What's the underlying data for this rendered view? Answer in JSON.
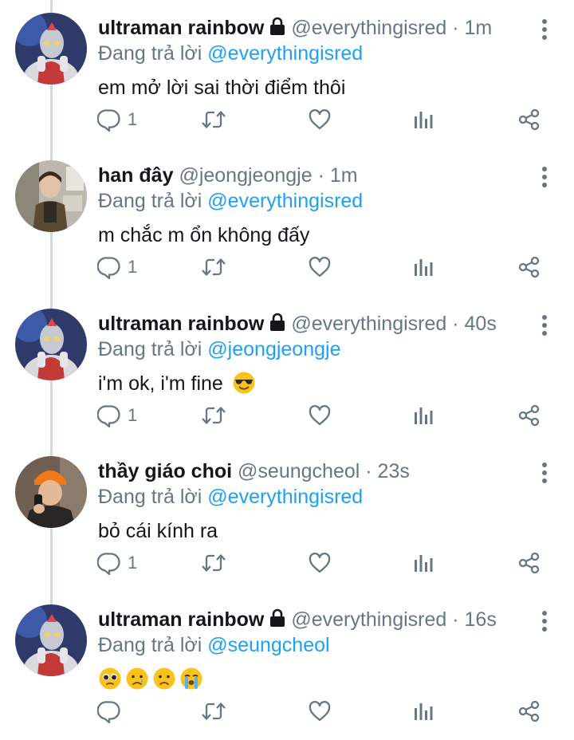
{
  "tweets": [
    {
      "name": "ultraman rainbow",
      "locked": true,
      "handle": "@everythingisred",
      "separator": "·",
      "time": "1m",
      "reply_prefix": "Đang trả lời",
      "reply_to": "@everythingisred",
      "text": "em mở lời sai thời điểm thôi",
      "reply_count": "1",
      "avatar": "ultraman-avatar"
    },
    {
      "name": "han đây",
      "locked": false,
      "handle": "@jeongjeongje",
      "separator": "·",
      "time": "1m",
      "reply_prefix": "Đang trả lời",
      "reply_to": "@everythingisred",
      "text": "m chắc m ổn không đấy",
      "reply_count": "1",
      "avatar": "photo-avatar-han"
    },
    {
      "name": "ultraman rainbow",
      "locked": true,
      "handle": "@everythingisred",
      "separator": "·",
      "time": "40s",
      "reply_prefix": "Đang trả lời",
      "reply_to": "@jeongjeongje",
      "text": "i'm ok, i'm fine",
      "text_emoji": "smiling-face-with-sunglasses",
      "reply_count": "1",
      "avatar": "ultraman-avatar"
    },
    {
      "name": "thầy giáo choi",
      "locked": false,
      "handle": "@seungcheol",
      "separator": "·",
      "time": "23s",
      "reply_prefix": "Đang trả lời",
      "reply_to": "@everythingisred",
      "text": "bỏ cái kính ra",
      "reply_count": "1",
      "avatar": "photo-avatar-choi"
    },
    {
      "name": "ultraman rainbow",
      "locked": true,
      "handle": "@everythingisred",
      "separator": "·",
      "time": "16s",
      "reply_prefix": "Đang trả lời",
      "reply_to": "@seungcheol",
      "text": "",
      "emojis": [
        "pleading-face",
        "crying-face",
        "frowning-face",
        "loudly-crying-face"
      ],
      "reply_count": "",
      "avatar": "ultraman-avatar"
    }
  ],
  "icons": {
    "reply": "reply-icon",
    "retweet": "retweet-icon",
    "like": "heart-icon",
    "analytics": "analytics-icon",
    "share": "share-icon",
    "more": "more-vertical-icon",
    "lock": "lock-icon"
  },
  "colors": {
    "accent": "#1da1f2",
    "secondary_text": "#657786",
    "primary_text": "#14171a",
    "thread_line": "#cfd9de"
  }
}
